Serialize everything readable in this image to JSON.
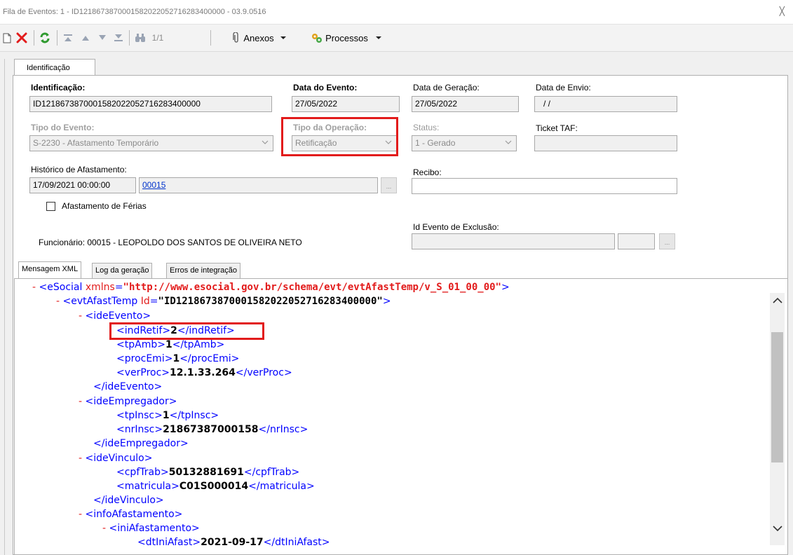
{
  "window": {
    "title": "Fila de Eventos: 1 - ID1218673870001582022052716283400000 - 03.9.0516",
    "close_glyph": "╳"
  },
  "toolbar": {
    "page_indicator": "1/1",
    "attachments_label": "Anexos",
    "processes_label": "Processos"
  },
  "tabs": {
    "main": "Identificação"
  },
  "form": {
    "identificacao_label": "Identificação:",
    "identificacao_value": "ID1218673870001582022052716283400000",
    "data_evento_label": "Data do Evento:",
    "data_evento_value": "27/05/2022",
    "data_geracao_label": "Data de Geração:",
    "data_geracao_value": "27/05/2022",
    "data_envio_label": "Data de Envio:",
    "data_envio_value": "/ /",
    "tipo_evento_label": "Tipo do Evento:",
    "tipo_evento_value": "S-2230 - Afastamento Temporário",
    "tipo_operacao_label": "Tipo da Operação:",
    "tipo_operacao_value": "Retificação",
    "status_label": "Status:",
    "status_value": "1 - Gerado",
    "ticket_label": "Ticket TAF:",
    "ticket_value": "",
    "historico_label": "Histórico de Afastamento:",
    "historico_date": "17/09/2021 00:00:00",
    "historico_code": "00015",
    "recibo_label": "Recibo:",
    "recibo_value": "",
    "afastamento_ferias_label": "Afastamento de Férias",
    "afastamento_ferias_checked": false,
    "id_exclusao_label": "Id Evento de Exclusão:",
    "funcionario_text": "Funcionário: 00015 - LEOPOLDO DOS SANTOS DE OLIVEIRA NETO",
    "ellipsis": "..."
  },
  "inner_tabs": [
    "Mensagem XML",
    "Log da geração",
    "Erros de integração"
  ],
  "xml": {
    "root_tag": "eSocial",
    "root_attr_name": "xmlns",
    "root_attr_value": "\"http://www.esocial.gov.br/schema/evt/evtAfastTemp/v_S_01_00_00\"",
    "evt_tag": "evtAfastTemp",
    "evt_attr_name": "Id",
    "evt_attr_value": "\"ID1218673870001582022052716283400000\"",
    "ideEvento": "ideEvento",
    "indRetif": "indRetif",
    "indRetif_value": "2",
    "tpAmb": "tpAmb",
    "tpAmb_value": "1",
    "procEmi": "procEmi",
    "procEmi_value": "1",
    "verProc": "verProc",
    "verProc_value": "12.1.33.264",
    "ideEmpregador": "ideEmpregador",
    "tpInsc": "tpInsc",
    "tpInsc_value": "1",
    "nrInsc": "nrInsc",
    "nrInsc_value": "21867387000158",
    "ideVinculo": "ideVinculo",
    "cpfTrab": "cpfTrab",
    "cpfTrab_value": "50132881691",
    "matricula": "matricula",
    "matricula_value": "C01S000014",
    "infoAfastamento": "infoAfastamento",
    "iniAfastamento": "iniAfastamento",
    "dtIniAfast": "dtIniAfast",
    "dtIniAfast_value": "2021-09-17"
  },
  "colors": {
    "highlight": "#e21b1b",
    "xml_tag": "#0000ff",
    "xml_attr": "#e21b1b",
    "link": "#0033cc"
  }
}
